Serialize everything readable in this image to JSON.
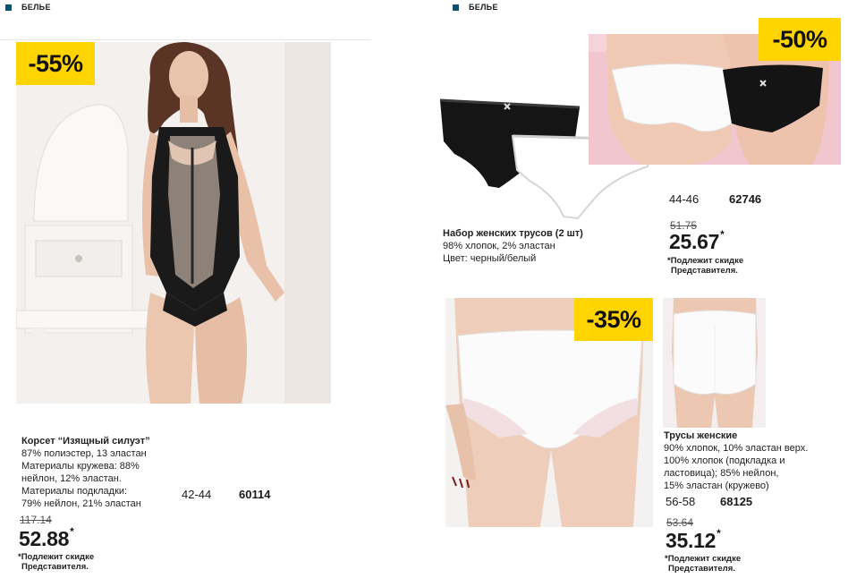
{
  "section_left": "БЕЛЬЕ",
  "section_right": "БЕЛЬЕ",
  "products": {
    "corset": {
      "discount": "-55%",
      "title": "Корсет “Изящный силуэт”",
      "lines": [
        "87% полиэстер, 13 эластан",
        "Материалы кружева: 88%",
        "нейлон, 12% эластан.",
        "Материалы подкладки:",
        "79% нейлон, 21% эластан"
      ],
      "size": "42-44",
      "code": "60114",
      "old_price": "117.14",
      "price": "52.88",
      "asterisk": "*",
      "note_line1": "*Подлежит скидке",
      "note_line2": "Представителя."
    },
    "briefs_set": {
      "discount": "-50%",
      "title": "Набор женских трусов (2 шт)",
      "lines": [
        "98% хлопок, 2% эластан",
        "Цвет: черный/белый"
      ],
      "size": "44-46",
      "code": "62746",
      "old_price": "51.75",
      "price": "25.67",
      "asterisk": "*",
      "note_line1": "*Подлежит скидке",
      "note_line2": "Представителя."
    },
    "briefs_women": {
      "discount": "-35%",
      "title": "Трусы женские",
      "lines": [
        "90% хлопок, 10% эластан верх.",
        "100% хлопок  (подкладка и",
        "ластовица); 85% нейлон,",
        "15% эластан (кружево)"
      ],
      "size": "56-58",
      "code": "68125",
      "old_price": "53.64",
      "price": "35.12",
      "asterisk": "*",
      "note_line1": "*Подлежит скидке",
      "note_line2": "Представителя."
    }
  },
  "colors": {
    "badge": "#ffd400",
    "bullet": "#0f4f6e",
    "pink_backdrop": "#f2c6cf"
  }
}
